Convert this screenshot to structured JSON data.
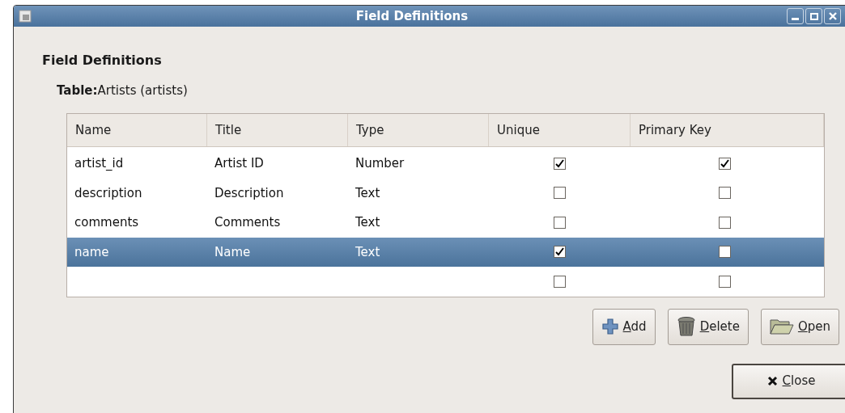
{
  "window": {
    "title": "Field Definitions"
  },
  "heading": "Field Definitions",
  "table_label": {
    "label": "Table:",
    "value": "Artists (artists)"
  },
  "table": {
    "columns": [
      "Name",
      "Title",
      "Type",
      "Unique",
      "Primary Key"
    ],
    "rows": [
      {
        "name": "artist_id",
        "title": "Artist ID",
        "type": "Number",
        "unique": true,
        "primary_key": true,
        "selected": false
      },
      {
        "name": "description",
        "title": "Description",
        "type": "Text",
        "unique": false,
        "primary_key": false,
        "selected": false
      },
      {
        "name": "comments",
        "title": "Comments",
        "type": "Text",
        "unique": false,
        "primary_key": false,
        "selected": false
      },
      {
        "name": "name",
        "title": "Name",
        "type": "Text",
        "unique": true,
        "primary_key": false,
        "selected": true
      },
      {
        "unique": false,
        "primary_key": false,
        "selected": false
      }
    ]
  },
  "row_buttons": [
    {
      "kind": "add",
      "label": "Add"
    },
    {
      "kind": "delete",
      "label": "Delete"
    },
    {
      "kind": "open",
      "label": "Open"
    }
  ],
  "close_button": {
    "label": "Close"
  }
}
